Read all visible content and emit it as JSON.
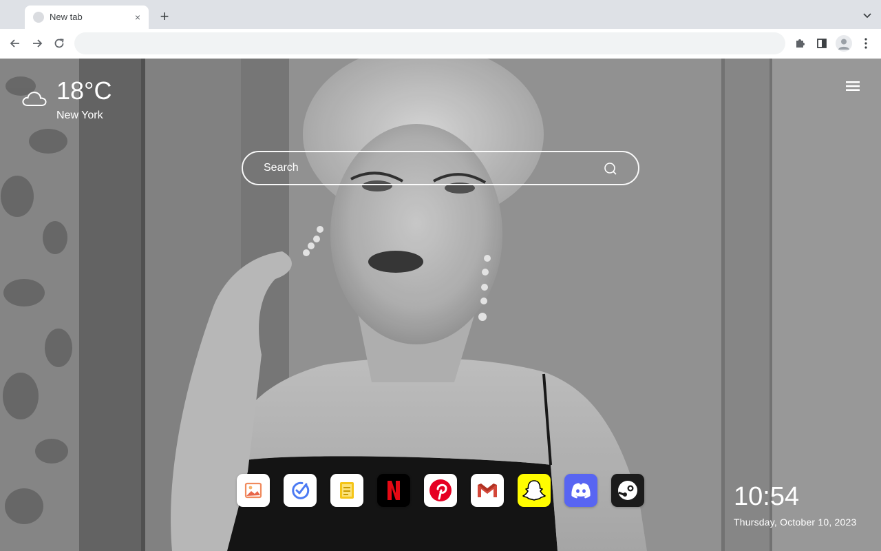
{
  "browser": {
    "tab": {
      "title": "New tab",
      "close_glyph": "×"
    },
    "new_tab_glyph": "+",
    "omnibox": {
      "value": "",
      "placeholder": ""
    }
  },
  "weather": {
    "temperature": "18°C",
    "city": "New York",
    "icon": "cloud-icon"
  },
  "search": {
    "placeholder": "Search"
  },
  "dock": {
    "apps": [
      {
        "name": "Photos",
        "icon": "photos-icon",
        "color": "#ffffff"
      },
      {
        "name": "Tasks",
        "icon": "tasks-icon",
        "color": "#ffffff"
      },
      {
        "name": "Notes",
        "icon": "notes-icon",
        "color": "#ffffff"
      },
      {
        "name": "Netflix",
        "icon": "netflix-icon",
        "color": "#000000"
      },
      {
        "name": "Pinterest",
        "icon": "pinterest-icon",
        "color": "#ffffff"
      },
      {
        "name": "Gmail",
        "icon": "gmail-icon",
        "color": "#ffffff"
      },
      {
        "name": "Snapchat",
        "icon": "snapchat-icon",
        "color": "#fffc00"
      },
      {
        "name": "Discord",
        "icon": "discord-icon",
        "color": "#5865f2"
      },
      {
        "name": "Steam",
        "icon": "steam-icon",
        "color": "#1b1b1b"
      }
    ]
  },
  "clock": {
    "time": "10:54",
    "date": "Thursday, October 10, 2023"
  }
}
